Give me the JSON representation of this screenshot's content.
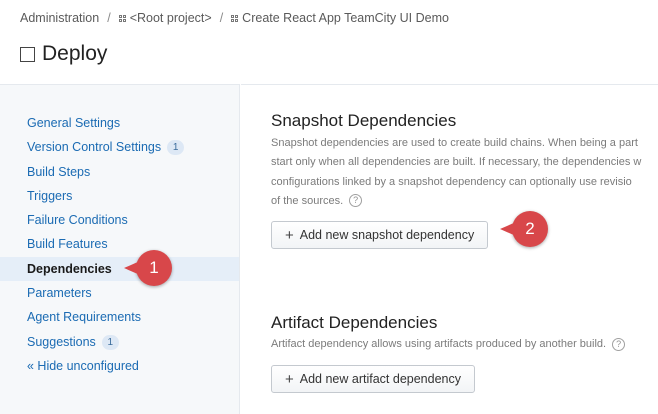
{
  "breadcrumb": {
    "admin": "Administration",
    "root": "<Root project>",
    "project": "Create React App TeamCity UI Demo",
    "separator": "/"
  },
  "page": {
    "title": "Deploy"
  },
  "sidebar": {
    "items": [
      {
        "label": "General Settings",
        "badge": ""
      },
      {
        "label": "Version Control Settings",
        "badge": "1"
      },
      {
        "label": "Build Steps",
        "badge": ""
      },
      {
        "label": "Triggers",
        "badge": ""
      },
      {
        "label": "Failure Conditions",
        "badge": ""
      },
      {
        "label": "Build Features",
        "badge": ""
      },
      {
        "label": "Dependencies",
        "badge": "",
        "active": true
      },
      {
        "label": "Parameters",
        "badge": ""
      },
      {
        "label": "Agent Requirements",
        "badge": ""
      },
      {
        "label": "Suggestions",
        "badge": "1"
      }
    ],
    "hide_link": "« Hide unconfigured"
  },
  "snapshot": {
    "title": "Snapshot Dependencies",
    "desc_lines": [
      "Snapshot dependencies are used to create build chains. When being a part",
      "start only when all dependencies are built. If necessary, the dependencies w",
      "configurations linked by a snapshot dependency can optionally use revisio",
      "of the sources."
    ],
    "add_button": "Add new snapshot dependency"
  },
  "artifact": {
    "title": "Artifact Dependencies",
    "desc": "Artifact dependency allows using artifacts produced by another build.",
    "add_button": "Add new artifact dependency"
  },
  "callouts": {
    "one": "1",
    "two": "2"
  },
  "icons": {
    "help": "?",
    "plus": "+"
  },
  "colors": {
    "link": "#1b6bb3",
    "callout": "#d8474a",
    "sidebar_bg": "#f6f8fa",
    "active_bg": "#e5eef8"
  }
}
